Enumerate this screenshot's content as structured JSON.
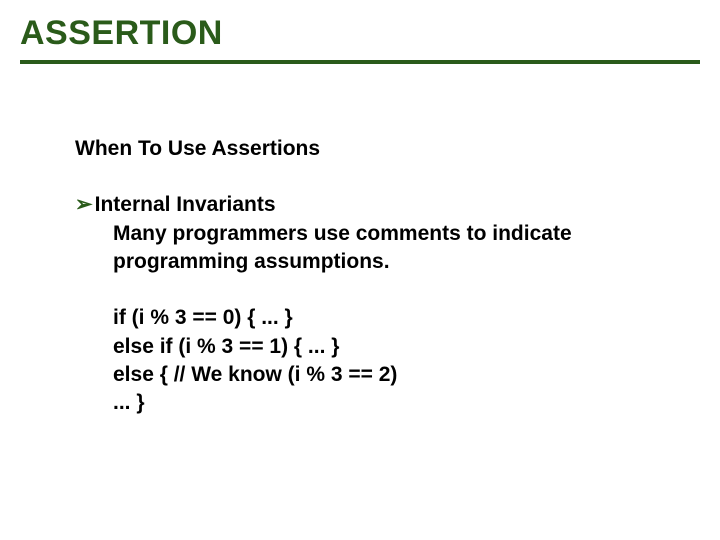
{
  "title": "ASSERTION",
  "subhead": "When To Use Assertions",
  "bullet": {
    "heading": "Internal Invariants",
    "para": "Many programmers use comments to indicate programming assumptions."
  },
  "code": {
    "l1": "if (i % 3 == 0) { ... }",
    "l2": "else if (i % 3 == 1) { ... }",
    "l3": "else { // We know (i % 3 == 2)",
    "l4": "... }"
  }
}
